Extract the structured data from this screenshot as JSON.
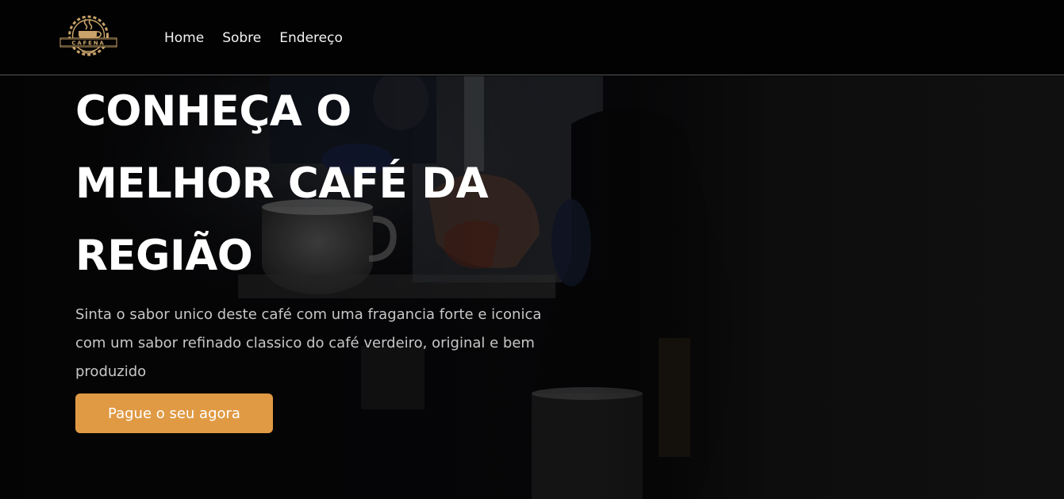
{
  "logo": {
    "text": "CAFENA"
  },
  "nav": {
    "items": [
      {
        "label": "Home"
      },
      {
        "label": "Sobre"
      },
      {
        "label": "Endereço"
      }
    ]
  },
  "hero": {
    "title": "CONHEÇA O MELHOR CAFÉ DA REGIÃO",
    "description": "Sinta o sabor unico deste café com uma fragancia forte e iconica com um sabor refinado classico do café verdeiro, original e bem produzido",
    "cta_label": "Pague o seu agora"
  },
  "colors": {
    "header_bg": "#020202",
    "accent": "#e09a44",
    "logo_gold": "#c9a36a",
    "text": "#ffffff"
  }
}
